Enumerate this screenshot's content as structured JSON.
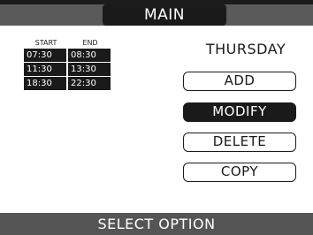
{
  "header": {
    "title": "MAIN"
  },
  "schedule": {
    "columns": {
      "start": "START",
      "end": "END"
    },
    "slots": [
      {
        "start": "07:30",
        "end": "08:30"
      },
      {
        "start": "11:30",
        "end": "13:30"
      },
      {
        "start": "18:30",
        "end": "22:30"
      }
    ]
  },
  "day": "THURSDAY",
  "menu": {
    "add": "ADD",
    "modify": "MODIFY",
    "delete": "DELETE",
    "copy": "COPY",
    "selected": "MODIFY"
  },
  "status": "SELECT OPTION",
  "colors": {
    "foreground": "#1a1a1a",
    "bar": "#555555",
    "background": "#ffffff"
  }
}
